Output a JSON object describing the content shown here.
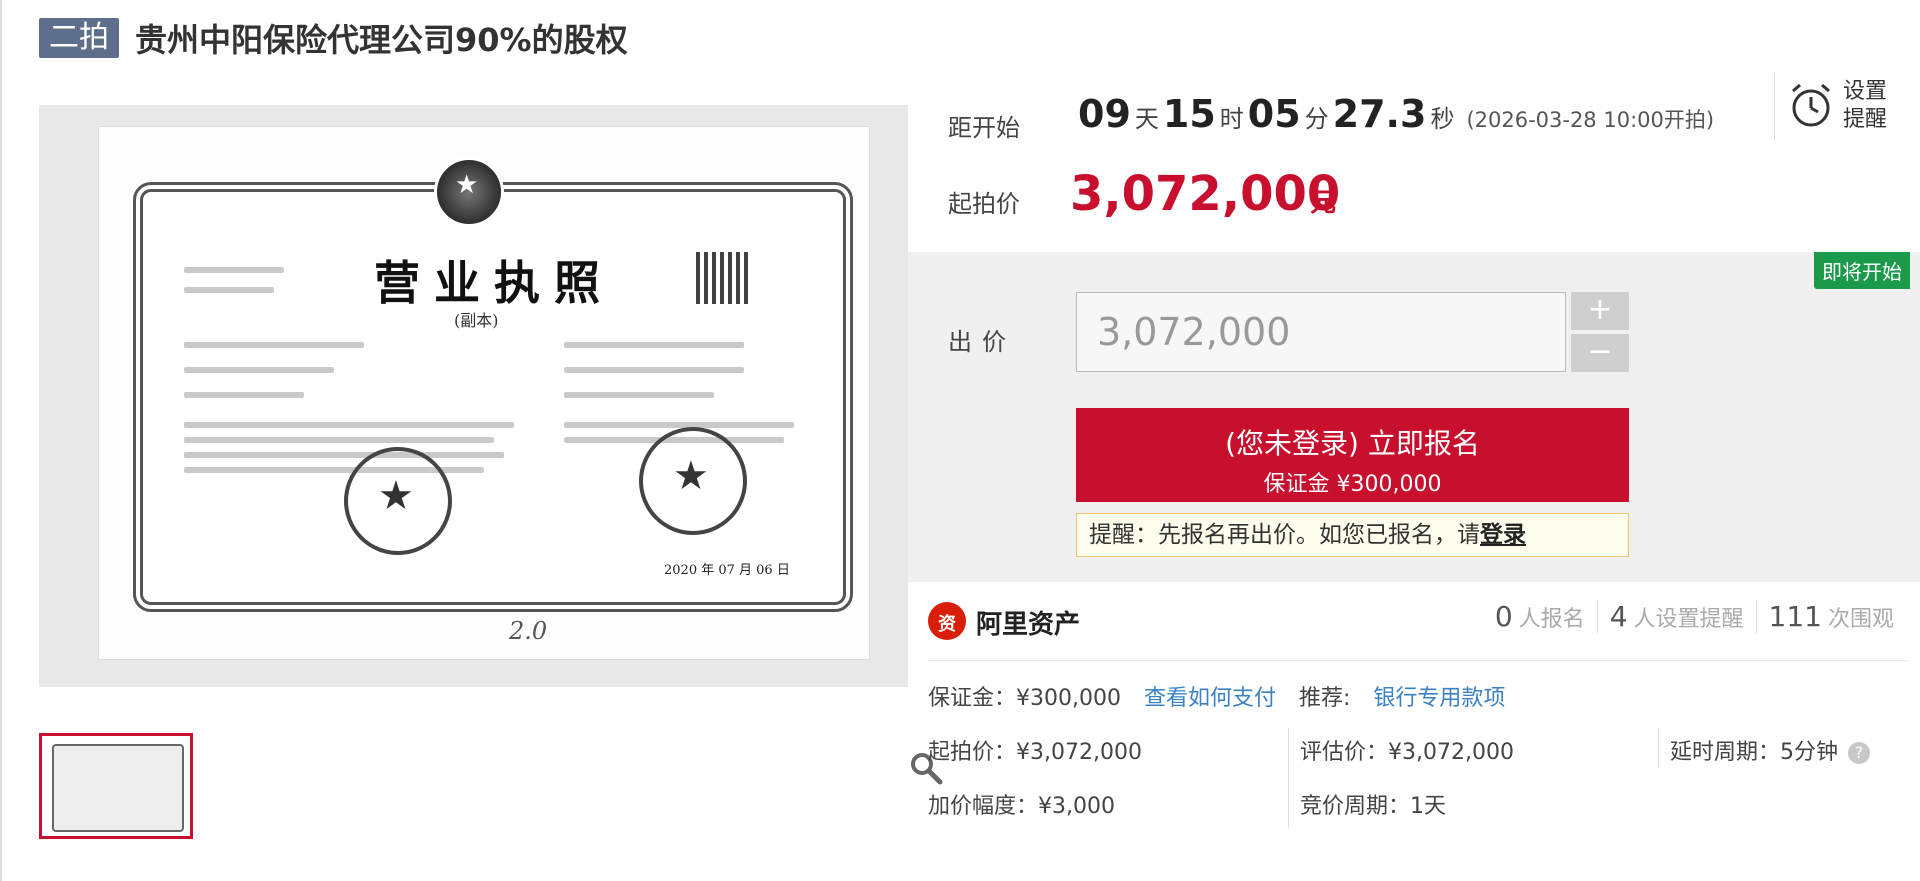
{
  "header": {
    "round_badge": "二拍",
    "title": "贵州中阳保险代理公司90%的股权"
  },
  "gallery": {
    "license_title": "营业执照",
    "license_subtitle": "(副本)",
    "license_date": "2020 年 07 月 06 日",
    "handwritten_mark": "2.0",
    "zoom_icon": "magnifier-icon"
  },
  "countdown": {
    "label": "距开始",
    "days": "09",
    "days_unit": "天",
    "hours": "15",
    "hours_unit": "时",
    "minutes": "05",
    "minutes_unit": "分",
    "seconds": "27.3",
    "seconds_unit": "秒",
    "open_time": "(2026-03-28 10:00开拍)"
  },
  "reminder": {
    "icon": "alarm-clock-icon",
    "label": "设置提醒"
  },
  "start_price": {
    "label": "起拍价",
    "value": "3,072,000",
    "unit": "元"
  },
  "bid": {
    "status_tag": "即将开始",
    "label": "出价",
    "input_value": "3,072,000",
    "plus": "+",
    "minus": "−",
    "signup_main": "(您未登录) 立即报名",
    "signup_sub": "保证金 ¥300,000",
    "notice_prefix": "提醒：先报名再出价。如您已报名，请",
    "notice_link": "登录"
  },
  "platform": {
    "name": "阿里资产",
    "logo_icon": "ali-asset-logo-icon"
  },
  "stats": [
    {
      "num": "0",
      "label": "人报名"
    },
    {
      "num": "4",
      "label": "人设置提醒"
    },
    {
      "num": "111",
      "label": "次围观"
    }
  ],
  "details": {
    "deposit": "保证金：¥300,000",
    "how_to_pay": "查看如何支付",
    "recommend_label": "推荐:",
    "recommend_link": "银行专用款项",
    "start_price": "起拍价：¥3,072,000",
    "appraisal": "评估价：¥3,072,000",
    "delay": "延时周期：5分钟",
    "increment": "加价幅度：¥3,000",
    "bid_cycle": "竞价周期：1天",
    "help_icon": "question-circle-icon"
  }
}
